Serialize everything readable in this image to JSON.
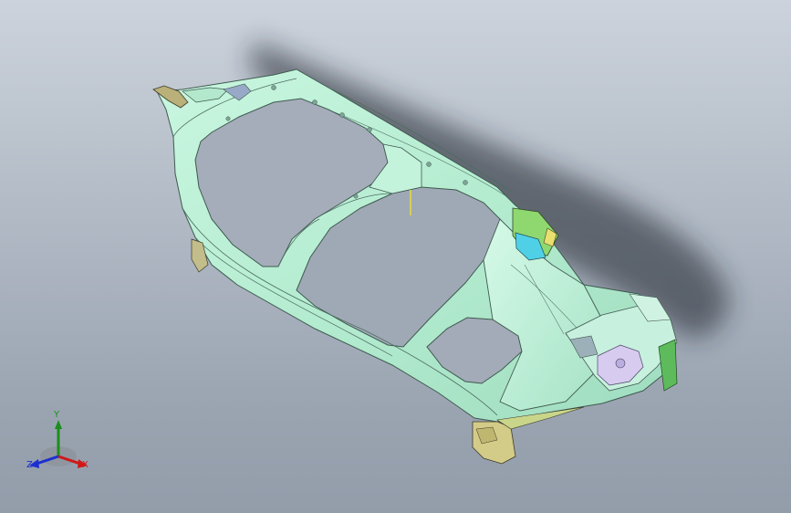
{
  "viewport": {
    "background_top": "#ccd3dc",
    "background_bottom": "#939daa",
    "model_color": "#b8f0d4",
    "model_edge_color": "#3f5a50",
    "shadow_color": "#2a2f36"
  },
  "triad": {
    "x_label": "X",
    "y_label": "Y",
    "z_label": "Z",
    "x_color": "#d01818",
    "y_color": "#1a8f1a",
    "z_color": "#1c2fd0"
  }
}
